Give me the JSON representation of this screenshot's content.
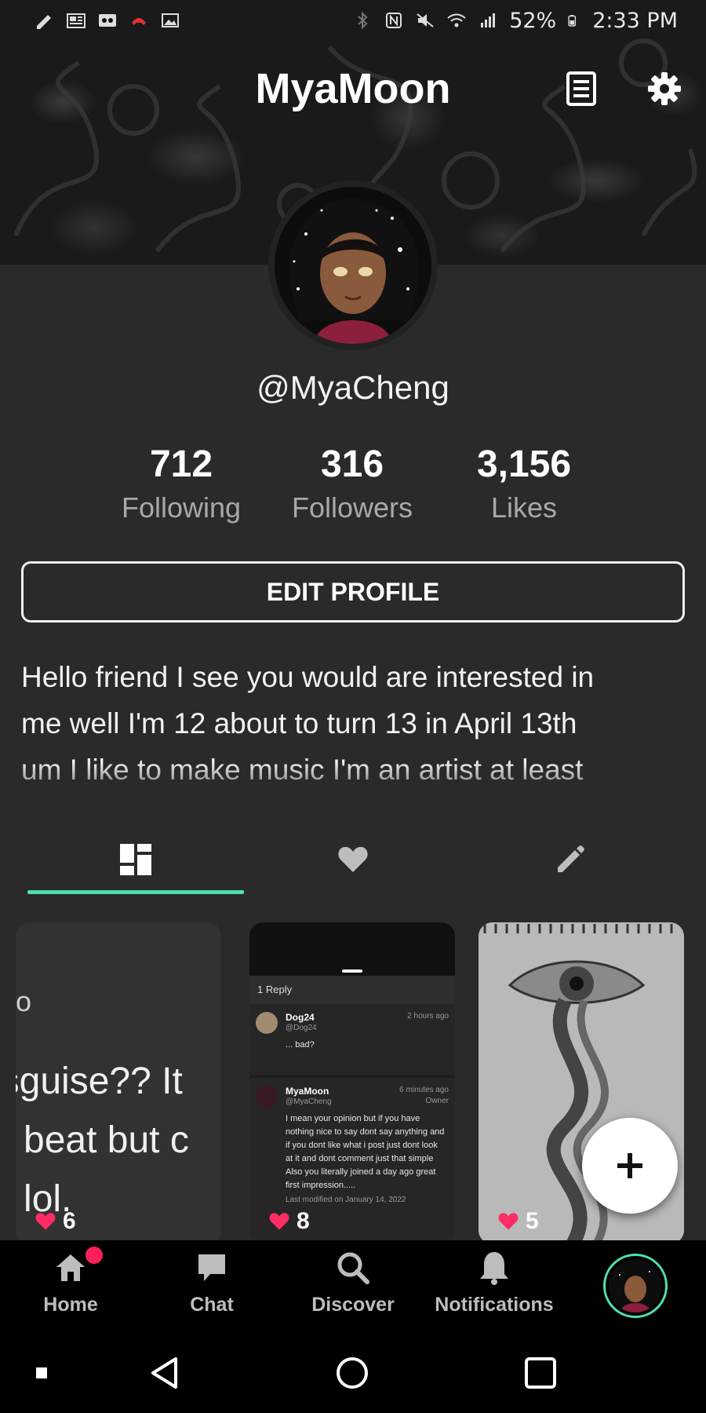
{
  "status_bar": {
    "battery": "52%",
    "time": "2:33 PM",
    "left_icons": [
      "edit-icon",
      "news-icon",
      "voicemail-icon",
      "missed-call-icon",
      "image-icon"
    ],
    "right_icons": [
      "bluetooth-icon",
      "nfc-icon",
      "mute-icon",
      "wifi-icon",
      "signal-icon",
      "battery-icon"
    ]
  },
  "header": {
    "title": "MyaMoon",
    "buttons": [
      "notes-icon",
      "settings-icon"
    ]
  },
  "profile": {
    "username": "@MyaCheng",
    "stats": [
      {
        "value": "712",
        "label": "Following"
      },
      {
        "value": "316",
        "label": "Followers"
      },
      {
        "value": "3,156",
        "label": "Likes"
      }
    ],
    "edit_button": "EDIT PROFILE",
    "bio_lines": [
      "Hello friend I see you would are interested in",
      "me well I'm 12 about to turn 13 in April 13th",
      "um I like to make music I'm an artist at least"
    ]
  },
  "tabs": [
    {
      "icon": "grid-icon",
      "active": true
    },
    {
      "icon": "heart-icon",
      "active": false
    },
    {
      "icon": "pencil-icon",
      "active": false
    }
  ],
  "cards": [
    {
      "text_lines": [
        "oto",
        "isguise?? It",
        "a beat but c",
        "g lol."
      ],
      "likes": "6"
    },
    {
      "reply_count": "1 Reply",
      "comments": [
        {
          "name": "Dog24",
          "handle": "@Dog24",
          "time": "2 hours ago",
          "body": "... bad?"
        },
        {
          "name": "MyaMoon",
          "handle": "@MyaCheng",
          "time": "6 minutes ago",
          "role": "Owner",
          "body": "I mean your opinion but if you have nothing nice to say dont say anything and if you dont like what i post just dont look at it and dont comment just that simple Also you literally joined a day ago great first impression.....",
          "footer": "Last modified on January 14, 2022"
        }
      ],
      "likes": "8"
    },
    {
      "likes": "5"
    }
  ],
  "fab": {
    "icon": "plus-icon"
  },
  "bottom_nav": [
    {
      "label": "Home",
      "icon": "home-icon",
      "has_badge": true
    },
    {
      "label": "Chat",
      "icon": "chat-icon"
    },
    {
      "label": "Discover",
      "icon": "search-icon"
    },
    {
      "label": "Notifications",
      "icon": "bell-icon"
    }
  ],
  "colors": {
    "accent": "#4fe0b0",
    "like": "#ff2d63",
    "panel": "#2b2a2b"
  }
}
